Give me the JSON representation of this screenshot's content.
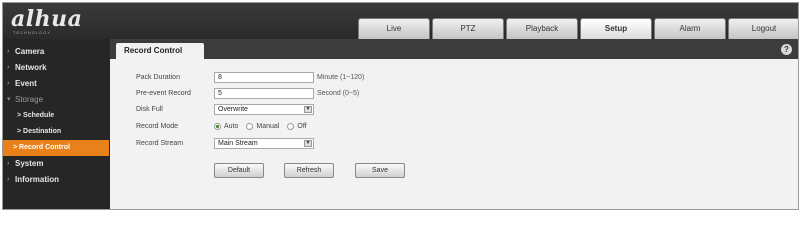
{
  "brand": {
    "logo": "alhua",
    "tagline": "TECHNOLOGY"
  },
  "nav": [
    "Live",
    "PTZ",
    "Playback",
    "Setup",
    "Alarm",
    "Logout"
  ],
  "page_title": "Record Control",
  "help_label": "?",
  "sidebar": {
    "camera": "Camera",
    "network": "Network",
    "event": "Event",
    "storage": "Storage",
    "schedule": "> Schedule",
    "destination": "> Destination",
    "record_control": "> Record Control",
    "system": "System",
    "information": "Information"
  },
  "form": {
    "pack_duration": {
      "label": "Pack Duration",
      "value": "8",
      "unit": "Minute (1~120)"
    },
    "pre_event_record": {
      "label": "Pre-event Record",
      "value": "5",
      "unit": "Second (0~5)"
    },
    "disk_full": {
      "label": "Disk Full",
      "value": "Overwrite"
    },
    "record_mode": {
      "label": "Record Mode",
      "options": [
        "Auto",
        "Manual",
        "Off"
      ],
      "selected": "Auto"
    },
    "record_stream": {
      "label": "Record Stream",
      "value": "Main Stream"
    }
  },
  "buttons": {
    "default": "Default",
    "refresh": "Refresh",
    "save": "Save"
  },
  "colors": {
    "accent": "#e8811b",
    "sidebar_bg": "#262626",
    "header_bg": "#333333"
  }
}
